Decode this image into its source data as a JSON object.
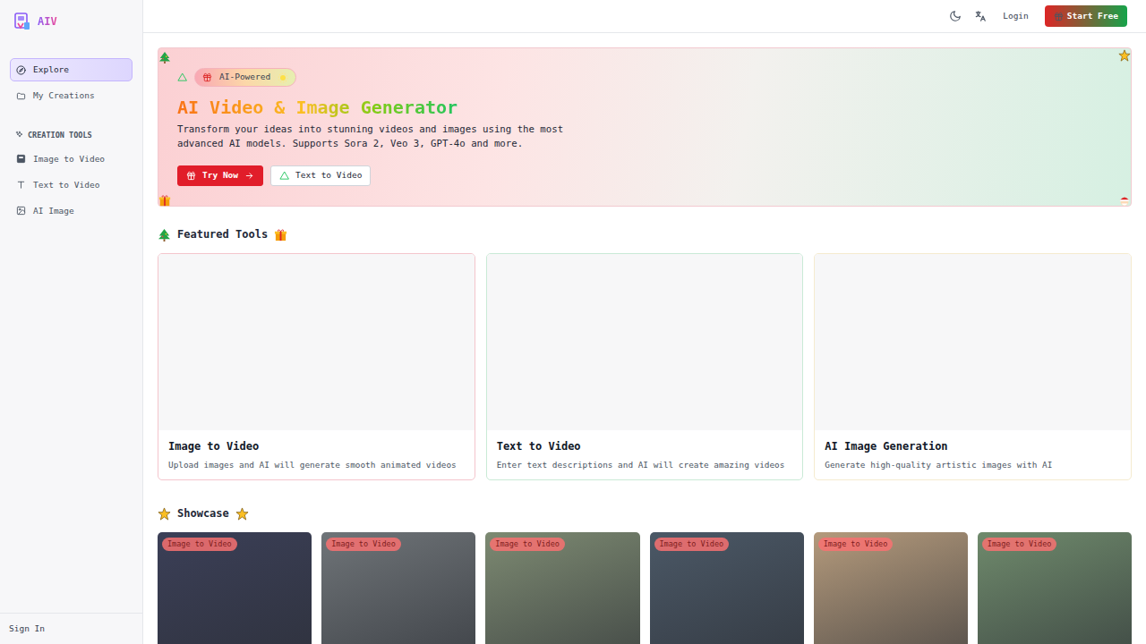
{
  "logo": {
    "text": "AIV"
  },
  "sidebar": {
    "items": [
      {
        "label": "Explore",
        "selected": true
      },
      {
        "label": "My Creations",
        "selected": false
      }
    ],
    "section": "CREATION TOOLS",
    "tools": [
      {
        "label": "Image to Video",
        "selected": false
      },
      {
        "label": "Text to Video",
        "selected": false
      },
      {
        "label": "AI Image",
        "selected": false
      }
    ],
    "footer": "Sign In"
  },
  "topbar": {
    "login": "Login",
    "cta": "Start Free"
  },
  "hero": {
    "badge": "AI-Powered",
    "title": "AI Video & Image Generator",
    "description": "Transform your ideas into stunning videos and images using the most advanced AI models. Supports Sora 2, Veo 3, GPT-4o and more.",
    "buttons": [
      {
        "label": "Try Now",
        "kind": "primary"
      },
      {
        "label": "Text to Video",
        "kind": "outline"
      }
    ]
  },
  "featured": {
    "title": "Featured Tools",
    "cards": [
      {
        "title": "Image to Video",
        "description": "Upload images and AI will generate smooth animated videos",
        "color": "#f4c5cc"
      },
      {
        "title": "Text to Video",
        "description": "Enter text descriptions and AI will create amazing videos",
        "color": "#c9ead6"
      },
      {
        "title": "AI Image Generation",
        "description": "Generate high-quality artistic images with AI",
        "color": "#f5ebcf"
      }
    ]
  },
  "showcase": {
    "title": "Showcase",
    "items": [
      {
        "badge": "Image to Video",
        "color": "#3b3f57"
      },
      {
        "badge": "Image to Video",
        "color": "#6f7478"
      },
      {
        "badge": "Image to Video",
        "color": "#7d8a72"
      },
      {
        "badge": "Image to Video",
        "color": "#4b5866"
      },
      {
        "badge": "Image to Video",
        "color": "#b49a7c"
      },
      {
        "badge": "Image to Video",
        "color": "#6f8a6c"
      }
    ]
  }
}
